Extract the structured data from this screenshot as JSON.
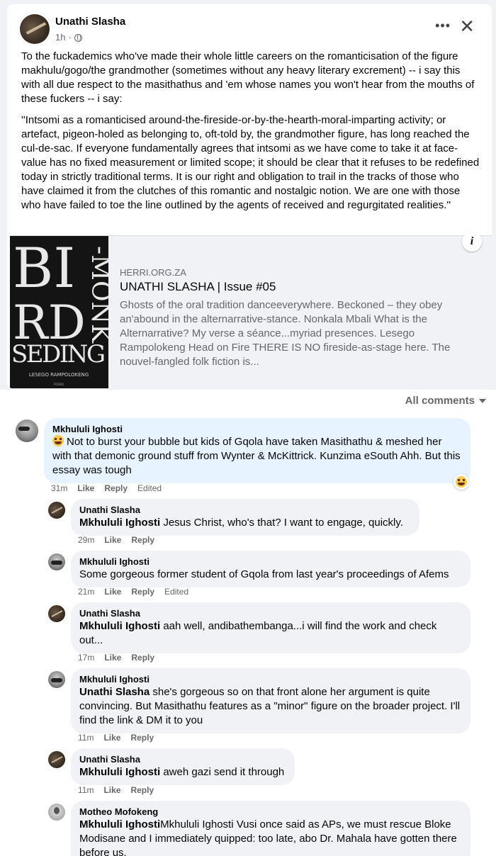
{
  "post": {
    "author": "Unathi Slasha",
    "time": "1h",
    "dot": "·",
    "more_icon": "more-options-icon",
    "close_icon": "close-icon",
    "paragraph1": "To the fuckademics who've made their whole little careers on the romanticisation of the figure makhulu/gogo/the grandmother (sometimes without any heavy literary excrement) -- i say this with all due respect to the masithathus and 'em whose names you won't hear from the mouths of these fuckers -- i say:",
    "paragraph2": "''Intsomi as a romanticised around-the-fireside-or-by-the-hearth-moral-imparting activity; or artefact, pigeon-holed as belonging to, oft-told by, the grandmother figure, has long reached the cul-de-sac. If everyone fundamentally agrees that intsomi as we have come to take it at face-value has no fixed measurement or limited scope; it should be clear that it refuses to be redefined today in strictly traditional terms. It is our right and obligation to trail in the tracks of those who have claimed it from the clutches of this romantic and nostalgic notion. We are one with those who have failed to toe the line outlined by the agents of received and regurgitated realities.''"
  },
  "link_preview": {
    "domain": "HERRI.ORG.ZA",
    "title": "UNATHI SLASHA | Issue #05",
    "description": "Ghosts of the oral tradition danceeverywhere. Beckoned – they obey an'abound in the alternarrative-stance. Nonkala Mbali  What is the Alternarrative? My verse a séance...myriad presences. Lesego Rampolokeng Head on Fire THERE IS NO fireside-as-stage here. The nouvel-fangled folk fiction is...",
    "info_label": "i",
    "book": {
      "line1": "BI",
      "line2": "RD",
      "line3": "SEDING",
      "side": "-MONK",
      "author": "LESEGO RAMPOLOKENG",
      "publisher": "POEMS"
    }
  },
  "comments_header": {
    "label": "All comments"
  },
  "comments": [
    {
      "name": "Mkhululi Ighosti",
      "mention": "",
      "text": "Not to burst your bubble but kids of Gqola have taken Masithathu & meshed her with that demonic ground stuff from Wynter & McKittrick. Kunzima eSouth Ahh. But this essay was tough",
      "time": "31m",
      "like": "Like",
      "reply": "Reply",
      "edited": "Edited"
    },
    {
      "name": "Unathi Slasha",
      "mention": "Mkhululi Ighosti",
      "text": " Jesus Christ, who's that? I want to engage, quickly.",
      "time": "29m",
      "like": "Like",
      "reply": "Reply",
      "edited": ""
    },
    {
      "name": "Mkhululi Ighosti",
      "mention": "",
      "text": "Some gorgeous former student of Gqola from last year's proceedings of Afems",
      "time": "21m",
      "like": "Like",
      "reply": "Reply",
      "edited": "Edited"
    },
    {
      "name": "Unathi Slasha",
      "mention": "Mkhululi Ighosti",
      "text": " aah well, andibathembanga...i will find the work and check out...",
      "time": "17m",
      "like": "Like",
      "reply": "Reply",
      "edited": ""
    },
    {
      "name": "Mkhululi Ighosti",
      "mention": "Unathi Slasha",
      "text": " she's gorgeous so on that front alone her argument is quite convincing. But Masithathu features as a \"minor\" figure on the broader project. I'll find the link & DM it to you",
      "time": "11m",
      "like": "Like",
      "reply": "Reply",
      "edited": ""
    },
    {
      "name": "Unathi Slasha",
      "mention": "Mkhululi Ighosti",
      "text": " aweh gazi send it through",
      "time": "11m",
      "like": "Like",
      "reply": "Reply",
      "edited": ""
    },
    {
      "name": "Motheo Mofokeng",
      "mention": "Mkhululi Ighosti",
      "text": "Mkhululi Ighosti Vusi once said as APs, we must rescue Bloke Modisane and I immediately quipped: too late, abo Dr. Mahala have gotten there before us.",
      "time": "",
      "like": "",
      "reply": "",
      "edited": ""
    }
  ]
}
